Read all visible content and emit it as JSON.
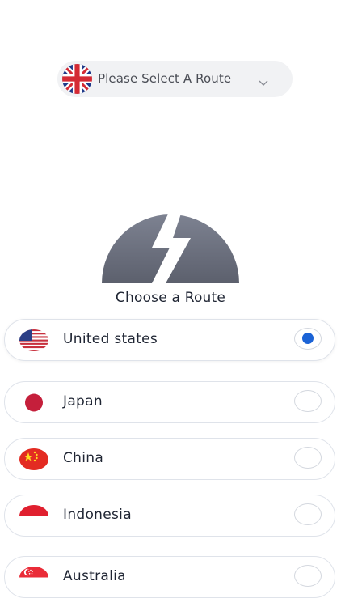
{
  "route_select": {
    "label": "Please Select A Route",
    "flag_icon": "uk-flag-icon",
    "chevron_icon": "chevron-down-icon"
  },
  "hero": {
    "icon": "lightning-bolt-icon",
    "title": "Choose a Route"
  },
  "routes": [
    {
      "name": "United states",
      "flag_icon": "us-flag-icon",
      "selected": true
    },
    {
      "name": "Japan",
      "flag_icon": "japan-flag-icon",
      "selected": false
    },
    {
      "name": "China",
      "flag_icon": "china-flag-icon",
      "selected": false
    },
    {
      "name": "Indonesia",
      "flag_icon": "indonesia-flag-icon",
      "selected": false
    },
    {
      "name": "Australia",
      "flag_icon": "singapore-flag-icon",
      "selected": false
    }
  ],
  "colors": {
    "accent": "#1b63d6",
    "hero_gray": "#6b6f7d",
    "row_border": "#dfe3ea"
  }
}
